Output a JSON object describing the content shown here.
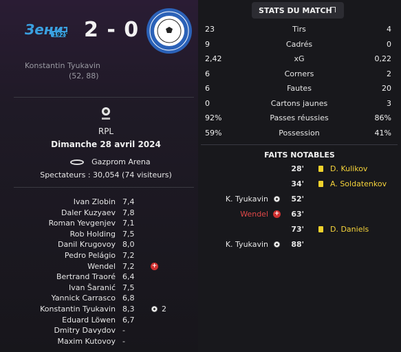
{
  "match": {
    "score": "2 - 0",
    "home_logo_text": "Зенит 1925",
    "away_logo_text": "ФУТБОЛЬНЫЙ КЛУБ ОРЕНБУРГ",
    "home_scorer": "Konstantin Tyukavin",
    "home_scorer_minutes": "(52, 88)"
  },
  "info": {
    "competition": "RPL",
    "date": "Dimanche 28 avril 2024",
    "stadium": "Gazprom Arena",
    "spectators": "Spectateurs : 30,054 (74 visiteurs)"
  },
  "lineup": [
    {
      "name": "Ivan Zlobin",
      "rating": "7,4"
    },
    {
      "name": "Daler Kuzyaev",
      "rating": "7,8"
    },
    {
      "name": "Roman Yevgenjev",
      "rating": "7,1"
    },
    {
      "name": "Rob Holding",
      "rating": "7,5"
    },
    {
      "name": "Danil Krugovoy",
      "rating": "8,0"
    },
    {
      "name": "Pedro Pelágio",
      "rating": "7,2"
    },
    {
      "name": "Wendel",
      "rating": "7,2",
      "icon": "injury-icon"
    },
    {
      "name": "Bertrand Traoré",
      "rating": "6,4"
    },
    {
      "name": "Ivan Šaranić",
      "rating": "7,5"
    },
    {
      "name": "Yannick Carrasco",
      "rating": "6,8"
    },
    {
      "name": "Konstantin Tyukavin",
      "rating": "8,3",
      "icon": "goal-icon",
      "goals": "2"
    },
    {
      "name": "Eduard Löwen",
      "rating": "6,7"
    },
    {
      "name": "Dmitry Davydov",
      "rating": "-"
    },
    {
      "name": "Maxim Kutovoy",
      "rating": "-"
    }
  ],
  "stats": {
    "header": "STATS DU MATCH",
    "rows": [
      {
        "label": "Tirs",
        "home": "23",
        "away": "4"
      },
      {
        "label": "Cadrés",
        "home": "9",
        "away": "0"
      },
      {
        "label": "xG",
        "home": "2,42",
        "away": "0,22"
      },
      {
        "label": "Corners",
        "home": "6",
        "away": "2"
      },
      {
        "label": "Fautes",
        "home": "6",
        "away": "20"
      },
      {
        "label": "Cartons jaunes",
        "home": "0",
        "away": "3"
      },
      {
        "label": "Passes réussies",
        "home": "92%",
        "away": "86%"
      },
      {
        "label": "Possession",
        "home": "59%",
        "away": "41%"
      }
    ]
  },
  "events": {
    "header": "FAITS NOTABLES",
    "items": [
      {
        "minute": "28'",
        "side": "away",
        "type": "yellow-card",
        "player": "D. Kulikov"
      },
      {
        "minute": "34'",
        "side": "away",
        "type": "yellow-card",
        "player": "A. Soldatenkov"
      },
      {
        "minute": "52'",
        "side": "home",
        "type": "goal",
        "player": "K. Tyukavin"
      },
      {
        "minute": "63'",
        "side": "home",
        "type": "injury",
        "player": "Wendel"
      },
      {
        "minute": "73'",
        "side": "away",
        "type": "yellow-card",
        "player": "D. Daniels"
      },
      {
        "minute": "88'",
        "side": "home",
        "type": "goal",
        "player": "K. Tyukavin"
      }
    ]
  },
  "colors": {
    "accent_red": "#d03030",
    "yellow": "#f0d22c",
    "injury_text": "#e04848"
  }
}
